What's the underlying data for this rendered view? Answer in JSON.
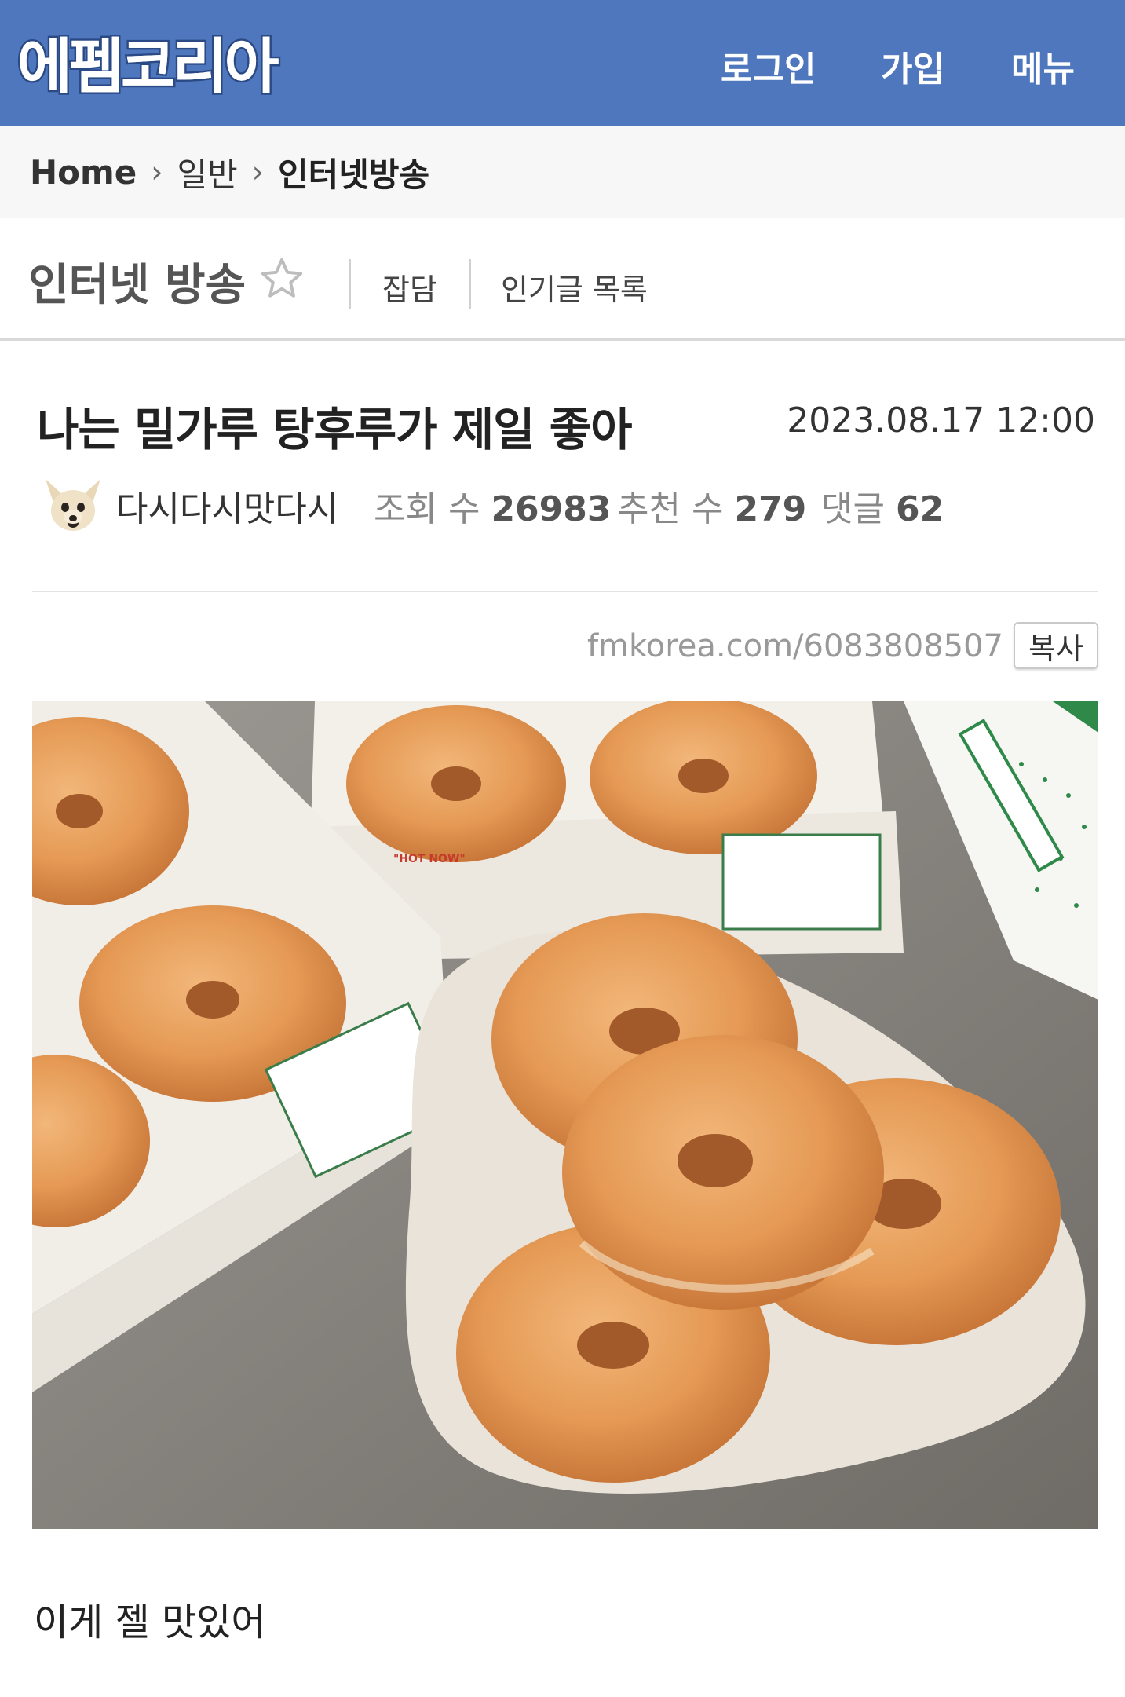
{
  "header": {
    "logo_text": "에펨코리아",
    "nav": {
      "login": "로그인",
      "join": "가입",
      "menu": "메뉴"
    },
    "color": "#4f77bd"
  },
  "breadcrumb": {
    "home": "Home",
    "sep": "›",
    "category": "일반",
    "current": "인터넷방송"
  },
  "board": {
    "title": "인터넷 방송",
    "links": {
      "chat": "잡담",
      "popular": "인기글 목록"
    }
  },
  "post": {
    "title": "나는 밀가루 탕후루가 제일 좋아",
    "date": "2023.08.17 12:00",
    "author": "다시다시맛다시",
    "views_label": "조회 수",
    "views": "26983",
    "reco_label": "추천 수",
    "reco": "279",
    "comments_label": "댓글",
    "comments": "62",
    "short_url": "fmkorea.com/6083808507",
    "copy_label": "복사",
    "body": "이게 젤 맛있어"
  },
  "icons": {
    "star": "star-icon",
    "chevron": "chevron-right-icon"
  }
}
